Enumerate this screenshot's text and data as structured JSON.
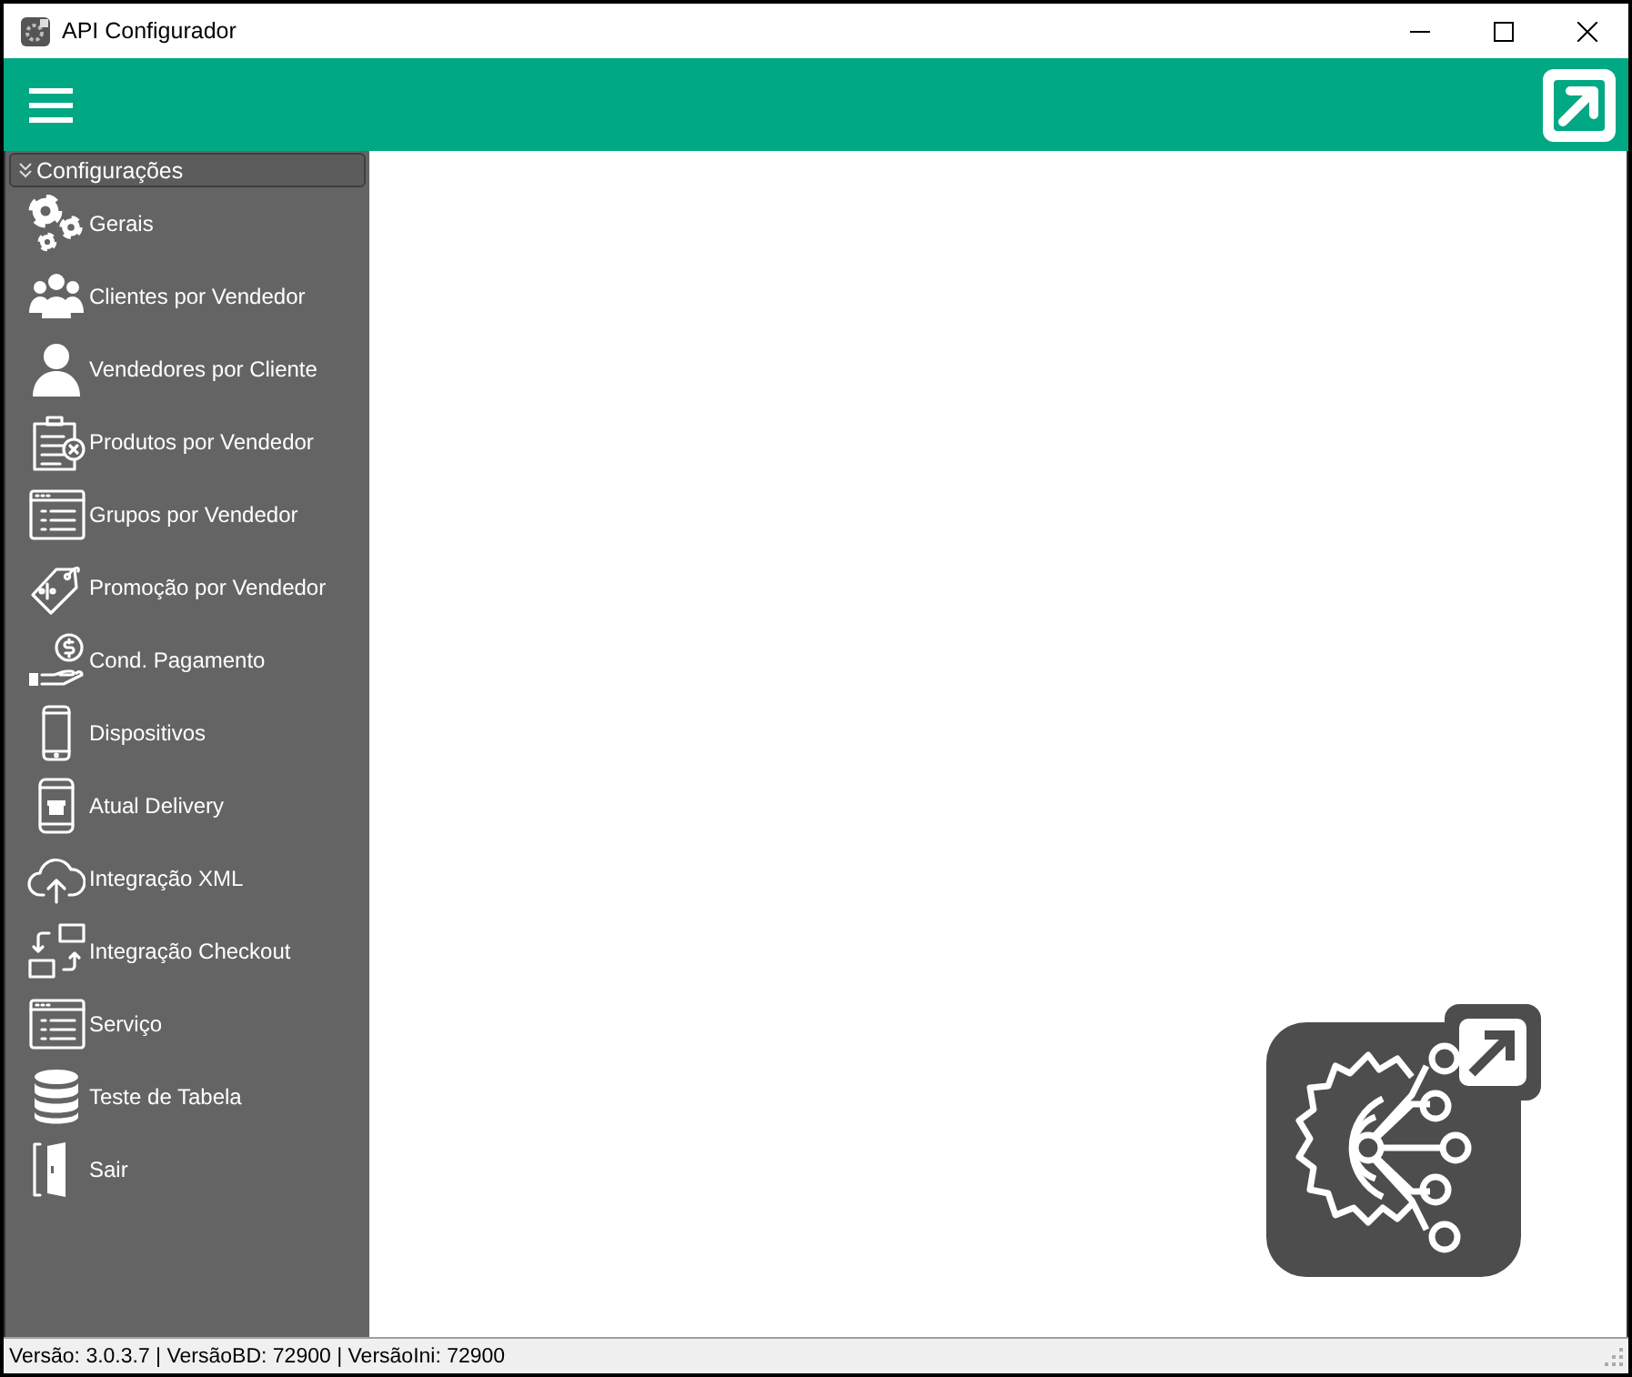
{
  "window": {
    "title": "API Configurador"
  },
  "menu": {
    "section": {
      "label": "Configurações",
      "expanded": true
    },
    "items": [
      {
        "label": "Gerais"
      },
      {
        "label": "Clientes por Vendedor"
      },
      {
        "label": "Vendedores por Cliente"
      },
      {
        "label": "Produtos por Vendedor"
      },
      {
        "label": "Grupos por Vendedor"
      },
      {
        "label": "Promoção por Vendedor"
      },
      {
        "label": "Cond. Pagamento"
      },
      {
        "label": "Dispositivos"
      },
      {
        "label": "Atual Delivery"
      },
      {
        "label": "Integração XML"
      },
      {
        "label": "Integração Checkout"
      },
      {
        "label": "Serviço"
      },
      {
        "label": "Teste de Tabela"
      },
      {
        "label": "Sair"
      }
    ]
  },
  "status_bar": {
    "text": "Versão: 3.0.3.7 | VersãoBD: 72900 | VersãoIni: 72900"
  }
}
